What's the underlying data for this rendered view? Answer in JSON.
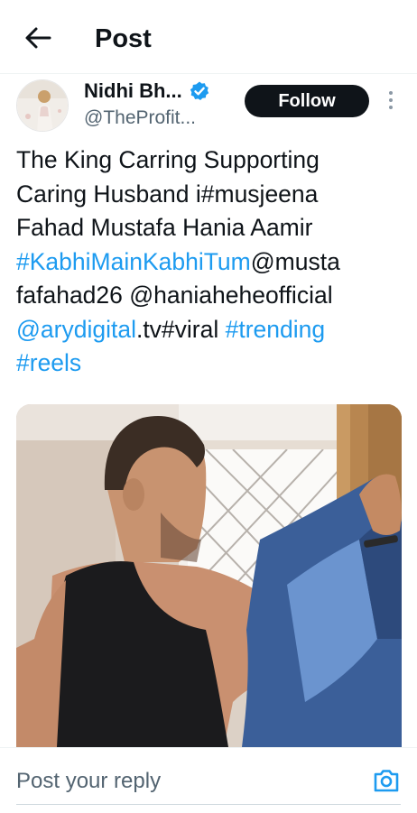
{
  "header": {
    "title": "Post",
    "back_icon": "arrow-left-icon"
  },
  "author": {
    "display_name": "Nidhi Bh...",
    "handle": "@TheProfit...",
    "verified_icon": "verified-badge-icon",
    "verified_color": "#1d9bf0",
    "follow_label": "Follow",
    "more_icon": "more-vertical-icon"
  },
  "post": {
    "lines": [
      [
        {
          "text": "The King Carring Supporting",
          "link": false
        }
      ],
      [
        {
          "text": "Caring Husband i#musjeena",
          "link": false
        }
      ],
      [
        {
          "text": "Fahad Mustafa Hania Aamir",
          "link": false
        }
      ],
      [
        {
          "text": "#KabhiMainKabhiTum",
          "link": true
        },
        {
          "text": "@musta",
          "link": false
        }
      ],
      [
        {
          "text": "fafahad26 @haniaheheofficial",
          "link": false
        }
      ],
      [
        {
          "text": "@arydigital",
          "link": true
        },
        {
          "text": ".tv#viral ",
          "link": false
        },
        {
          "text": "#trending",
          "link": true
        }
      ],
      [
        {
          "text": "#reels",
          "link": true
        }
      ]
    ],
    "link_color": "#1d9bf0"
  },
  "media": {
    "kind": "video-thumbnail"
  },
  "reply": {
    "placeholder": "Post your reply",
    "camera_icon": "camera-icon",
    "accent_color": "#1d9bf0"
  }
}
